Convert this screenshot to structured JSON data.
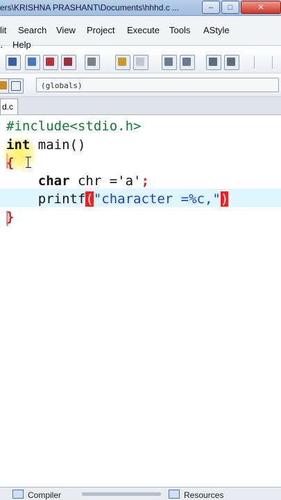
{
  "window": {
    "title": "ers\\KRISHNA PRASHANT\\Documents\\hhhd.c ..."
  },
  "menubar": {
    "row1": [
      "lit",
      "Search",
      "View",
      "Project",
      "Execute",
      "Tools",
      "AStyle"
    ],
    "row2": [
      "Help"
    ]
  },
  "toolbar": {
    "scope_dropdown": "(globals)"
  },
  "tab": {
    "file_label": "d.c"
  },
  "editor": {
    "lines": [
      {
        "tokens": [
          {
            "t": "#include<stdio.h>",
            "c": "#0a7f2e"
          }
        ]
      },
      {
        "tokens": [
          {
            "t": "int",
            "c": "#111111",
            "b": true
          },
          {
            "t": " main()",
            "c": "#111111"
          }
        ]
      },
      {
        "tokens": [
          {
            "t": "{",
            "c": "#d32020",
            "b": true
          }
        ]
      },
      {
        "tokens": [
          {
            "t": "    ",
            "c": "#111"
          },
          {
            "t": "char",
            "c": "#111111",
            "b": true
          },
          {
            "t": " chr ='a'",
            "c": "#111111"
          },
          {
            "t": ";",
            "c": "#d32020",
            "b": true
          }
        ]
      },
      {
        "tokens": [
          {
            "t": "    printf",
            "c": "#111111"
          },
          {
            "t": "(",
            "c": "#ffffff",
            "sel": true
          },
          {
            "t": "\"character =%c,\"",
            "c": "#1d3fd6"
          },
          {
            "t": ")",
            "c": "#ffffff",
            "sel": true
          }
        ]
      },
      {
        "tokens": [
          {
            "t": "}",
            "c": "#d32020",
            "b": true
          }
        ]
      }
    ]
  },
  "bottom_tabs": [
    "Compiler",
    "Resources"
  ],
  "colors": {
    "preprocessor": "#0a7f2e",
    "brace": "#d32020",
    "string": "#1d3fd6",
    "bracket_match": "#ff1a1a",
    "current_line": "#dff6ff"
  }
}
